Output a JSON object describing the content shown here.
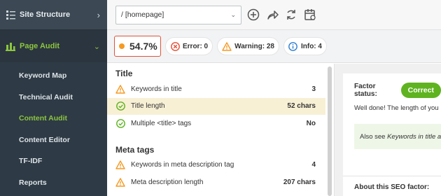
{
  "sidebar": {
    "site_structure": "Site Structure",
    "page_audit": "Page Audit",
    "items": [
      {
        "label": "Keyword Map"
      },
      {
        "label": "Technical Audit"
      },
      {
        "label": "Content Audit"
      },
      {
        "label": "Content Editor"
      },
      {
        "label": "TF-IDF"
      },
      {
        "label": "Reports"
      }
    ],
    "active_item": "Content Audit"
  },
  "toolbar": {
    "url_value": "/ [homepage]"
  },
  "scorebar": {
    "score": "54.7%",
    "error": "Error: 0",
    "warning": "Warning: 28",
    "info": "Info: 4"
  },
  "factors": {
    "sections": [
      {
        "title": "Title",
        "rows": [
          {
            "label": "Keywords in title",
            "value": "3",
            "status": "warning"
          },
          {
            "label": "Title length",
            "value": "52 chars",
            "status": "correct"
          },
          {
            "label": "Multiple <title> tags",
            "value": "No",
            "status": "correct"
          }
        ]
      },
      {
        "title": "Meta tags",
        "rows": [
          {
            "label": "Keywords in meta description tag",
            "value": "4",
            "status": "warning"
          },
          {
            "label": "Meta description length",
            "value": "207 chars",
            "status": "warning"
          }
        ]
      }
    ]
  },
  "detail": {
    "factor_status_label": "Factor status:",
    "status_badge": "Correct",
    "well_done": "Well done! The length of you",
    "also_see_prefix": "Also see ",
    "also_see_link": "Keywords in title a",
    "about": "About this SEO factor:"
  },
  "colors": {
    "accent_green": "#8cc63f",
    "correct_green": "#5fb320",
    "warning_orange": "#f59a23",
    "error_red": "#e0523a",
    "info_blue": "#2f7fd1"
  }
}
